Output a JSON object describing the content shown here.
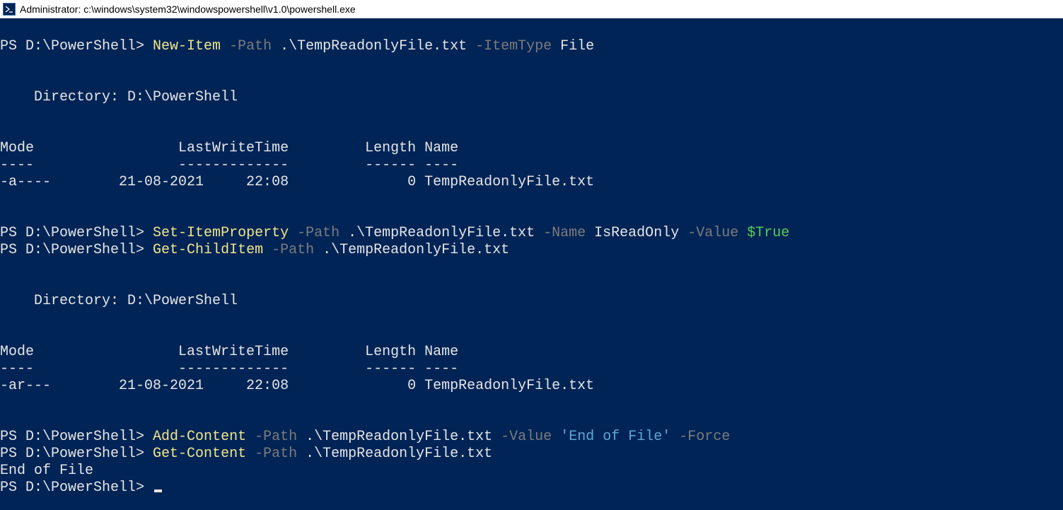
{
  "title": "Administrator: c:\\windows\\system32\\windowspowershell\\v1.0\\powershell.exe",
  "prompt": "PS D:\\PowerShell> ",
  "blank": "",
  "cmd1": {
    "cmdlet": "New-Item",
    "sp": " ",
    "p1": "-Path",
    "a1": " .\\TempReadonlyFile.txt ",
    "p2": "-ItemType",
    "a2": " File"
  },
  "dirline": "    Directory: D:\\PowerShell",
  "hdr": "Mode                 LastWriteTime         Length Name",
  "sep": "----                 -------------         ------ ----",
  "row1": "-a----        21-08-2021     22:08              0 TempReadonlyFile.txt",
  "cmd2": {
    "cmdlet": "Set-ItemProperty",
    "sp": " ",
    "p1": "-Path",
    "a1": " .\\TempReadonlyFile.txt ",
    "p2": "-Name",
    "a2": " IsReadOnly ",
    "p3": "-Value",
    "sp3": " ",
    "v": "$True"
  },
  "cmd3": {
    "cmdlet": "Get-ChildItem",
    "sp": " ",
    "p1": "-Path",
    "a1": " .\\TempReadonlyFile.txt"
  },
  "row2": "-ar---        21-08-2021     22:08              0 TempReadonlyFile.txt",
  "cmd4": {
    "cmdlet": "Add-Content",
    "sp": " ",
    "p1": "-Path",
    "a1": " .\\TempReadonlyFile.txt ",
    "p2": "-Value",
    "sp2": " ",
    "s": "'End of File'",
    "sp3": " ",
    "p3": "-Force"
  },
  "cmd5": {
    "cmdlet": "Get-Content",
    "sp": " ",
    "p1": "-Path",
    "a1": " .\\TempReadonlyFile.txt"
  },
  "out5": "End of File"
}
